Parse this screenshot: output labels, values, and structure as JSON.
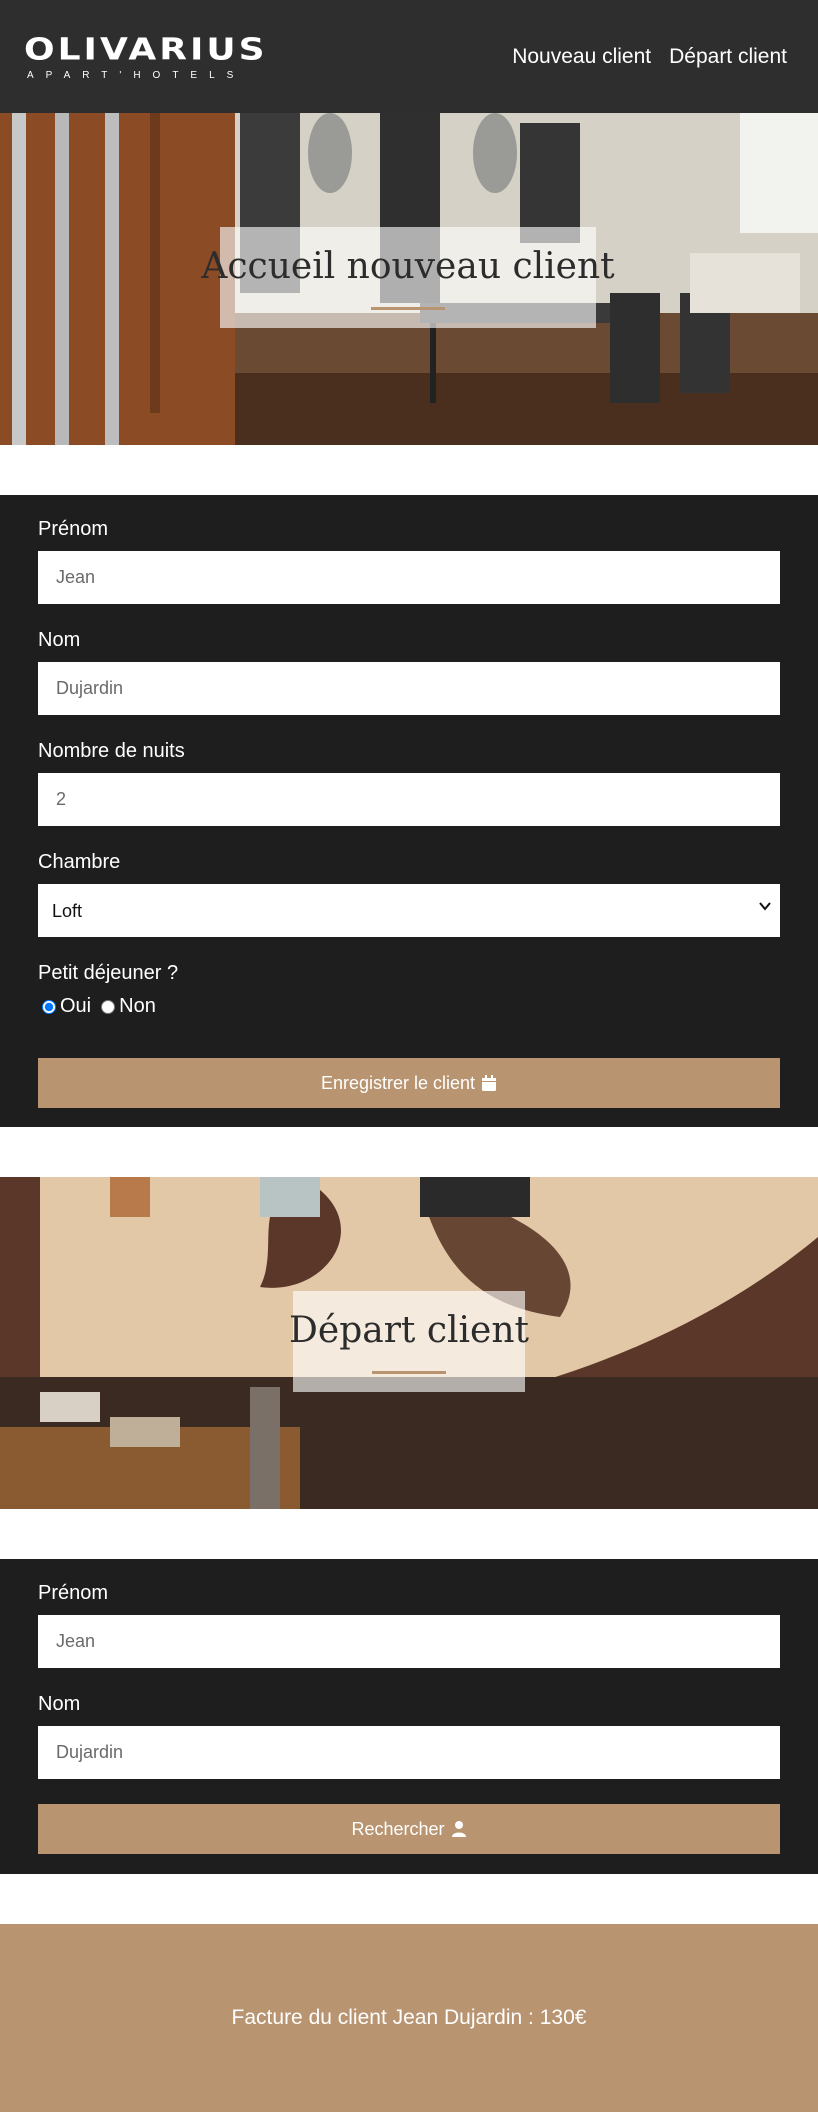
{
  "header": {
    "logo_main": "OLIVARIUS",
    "logo_sub": "APART'HOTELS",
    "nav": [
      "Nouveau client",
      "Départ client"
    ]
  },
  "hero_new_client": {
    "title": "Accueil nouveau client"
  },
  "new_client_form": {
    "firstname_label": "Prénom",
    "firstname_value": "Jean",
    "lastname_label": "Nom",
    "lastname_value": "Dujardin",
    "nights_label": "Nombre de nuits",
    "nights_value": "2",
    "room_label": "Chambre",
    "room_selected": "Loft",
    "breakfast_label": "Petit déjeuner ?",
    "breakfast_options": [
      "Oui",
      "Non"
    ],
    "breakfast_selected": "Oui",
    "submit_label": "Enregistrer le client",
    "submit_icon": "calendar-icon"
  },
  "hero_departure": {
    "title": "Départ client"
  },
  "departure_form": {
    "firstname_label": "Prénom",
    "firstname_value": "Jean",
    "lastname_label": "Nom",
    "lastname_value": "Dujardin",
    "search_label": "Rechercher",
    "search_icon": "user-icon"
  },
  "invoice": {
    "text": "Facture du client Jean Dujardin : 130€"
  },
  "colors": {
    "topbar": "#2e2e2e",
    "form_bg": "#1e1e1e",
    "accent": "#b89471"
  }
}
